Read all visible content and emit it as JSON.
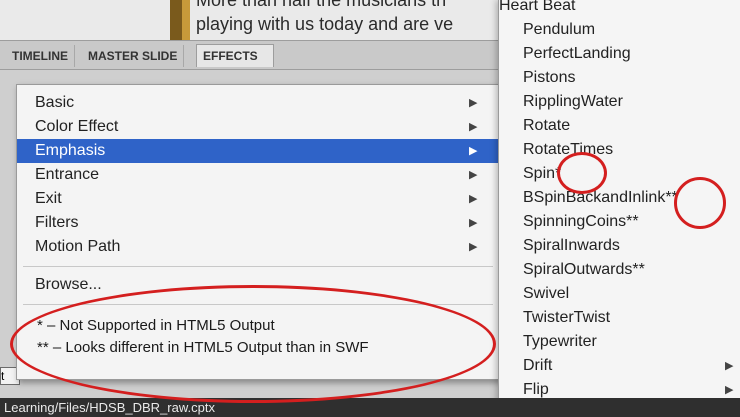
{
  "slide": {
    "line1": "More than half the musicians th",
    "line2": "playing with us today and are ve"
  },
  "tabs": [
    {
      "label": "TIMELINE"
    },
    {
      "label": "MASTER SLIDE"
    },
    {
      "label": "EFFECTS"
    }
  ],
  "context_menu": {
    "items": [
      {
        "label": "Basic",
        "submenu": true
      },
      {
        "label": "Color Effect",
        "submenu": true
      },
      {
        "label": "Emphasis",
        "submenu": true,
        "highlighted": true
      },
      {
        "label": "Entrance",
        "submenu": true
      },
      {
        "label": "Exit",
        "submenu": true
      },
      {
        "label": "Filters",
        "submenu": true
      },
      {
        "label": "Motion Path",
        "submenu": true
      }
    ],
    "browse": "Browse...",
    "notes": [
      "* – Not Supported in HTML5 Output",
      "** – Looks different in HTML5 Output than in SWF"
    ]
  },
  "submenu": {
    "items": [
      "Heart Beat",
      "Pendulum",
      "PerfectLanding",
      "Pistons",
      "RipplingWater",
      "Rotate",
      "RotateTimes",
      "Spin*",
      "BSpinBackandInlink**",
      "SpinningCoins**",
      "SpiralInwards",
      "SpiralOutwards**",
      "Swivel",
      "TwisterTwist",
      "Typewriter",
      "Drift",
      "Flip"
    ]
  },
  "field_text": "t",
  "status_bar": "Learning/Files/HDSB_DBR_raw.cptx",
  "colors": {
    "highlight": "#2f63c8",
    "annotation": "#d41f1f"
  },
  "icons": {
    "submenu_arrow": "triangle-right"
  }
}
